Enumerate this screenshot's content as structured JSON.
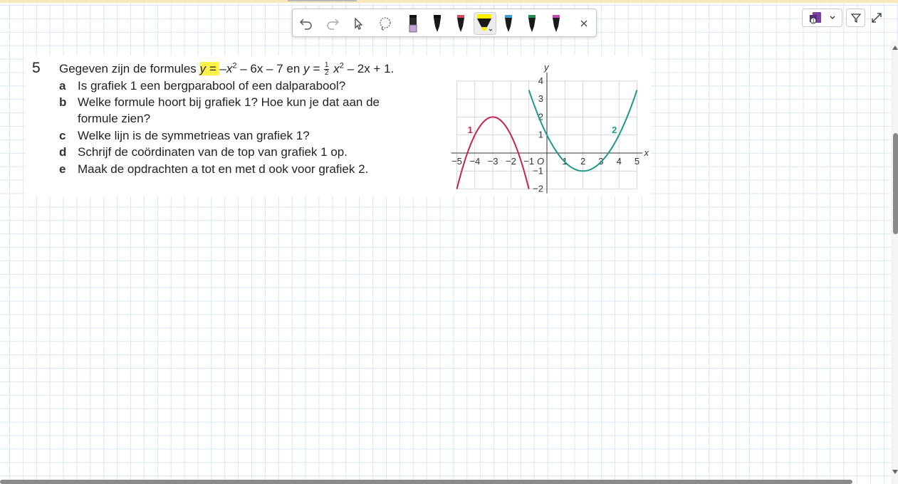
{
  "toolbar": {
    "icons": [
      "undo-icon",
      "redo-icon",
      "select-icon",
      "lasso-icon",
      "pen-violet",
      "pen-black",
      "pen-red",
      "highlighter-yellow",
      "pen-blue",
      "pen-green",
      "pen-magenta",
      "close-icon"
    ],
    "pen_colors": {
      "violet": "#c9a0dc",
      "black": "#1a1a1a",
      "red": "#d64a5a",
      "yellow": "#ffee00",
      "blue": "#3aa0d8",
      "green": "#1f8f56",
      "magenta": "#c94ab0"
    }
  },
  "right_tools": {
    "icons": [
      "onenote-icon",
      "chevron-down-icon",
      "filter-icon",
      "expand-icon"
    ]
  },
  "exercise": {
    "number": "5",
    "intro_start": "Gegeven zijn de formules ",
    "f1_highlight": "y = ",
    "f1_rest": "–x",
    "f1_sup": "2",
    "f1_tail": " – 6x – 7 en ",
    "f2_lhs": "y = ",
    "f2_num": "1",
    "f2_den": "2",
    "f2_x": " x",
    "f2_sup": "2",
    "f2_tail": " – 2x + 1.",
    "questions": [
      {
        "letter": "a",
        "text": "Is grafiek 1 een bergparabool of een dalparabool?"
      },
      {
        "letter": "b",
        "text": "Welke formule hoort bij grafiek 1? Hoe kun je dat aan de"
      },
      {
        "letter": "",
        "text": "formule zien?"
      },
      {
        "letter": "c",
        "text": "Welke lijn is de symmetrieas van grafiek 1?"
      },
      {
        "letter": "d",
        "text": "Schrijf de coördinaten van de top van grafiek 1 op."
      },
      {
        "letter": "e",
        "text": "Maak de opdrachten a tot en met d ook voor grafiek 2."
      }
    ]
  },
  "chart_data": {
    "type": "line",
    "xlabel": "x",
    "ylabel": "y",
    "origin_label": "O",
    "xlim": [
      -5,
      5
    ],
    "ylim": [
      -2,
      4
    ],
    "x_ticks": [
      -5,
      -4,
      -3,
      -2,
      -1,
      1,
      2,
      3,
      4,
      5
    ],
    "y_ticks": [
      -2,
      -1,
      1,
      2,
      3,
      4
    ],
    "grid": true,
    "series": [
      {
        "name": "1",
        "color": "#c8234a",
        "formula": "y = -x^2 - 6x - 7",
        "x_range": [
          -5,
          -1
        ]
      },
      {
        "name": "2",
        "color": "#1a9a8a",
        "formula": "y = 0.5x^2 - 2x + 1",
        "x_range": [
          -1,
          5
        ]
      }
    ]
  }
}
